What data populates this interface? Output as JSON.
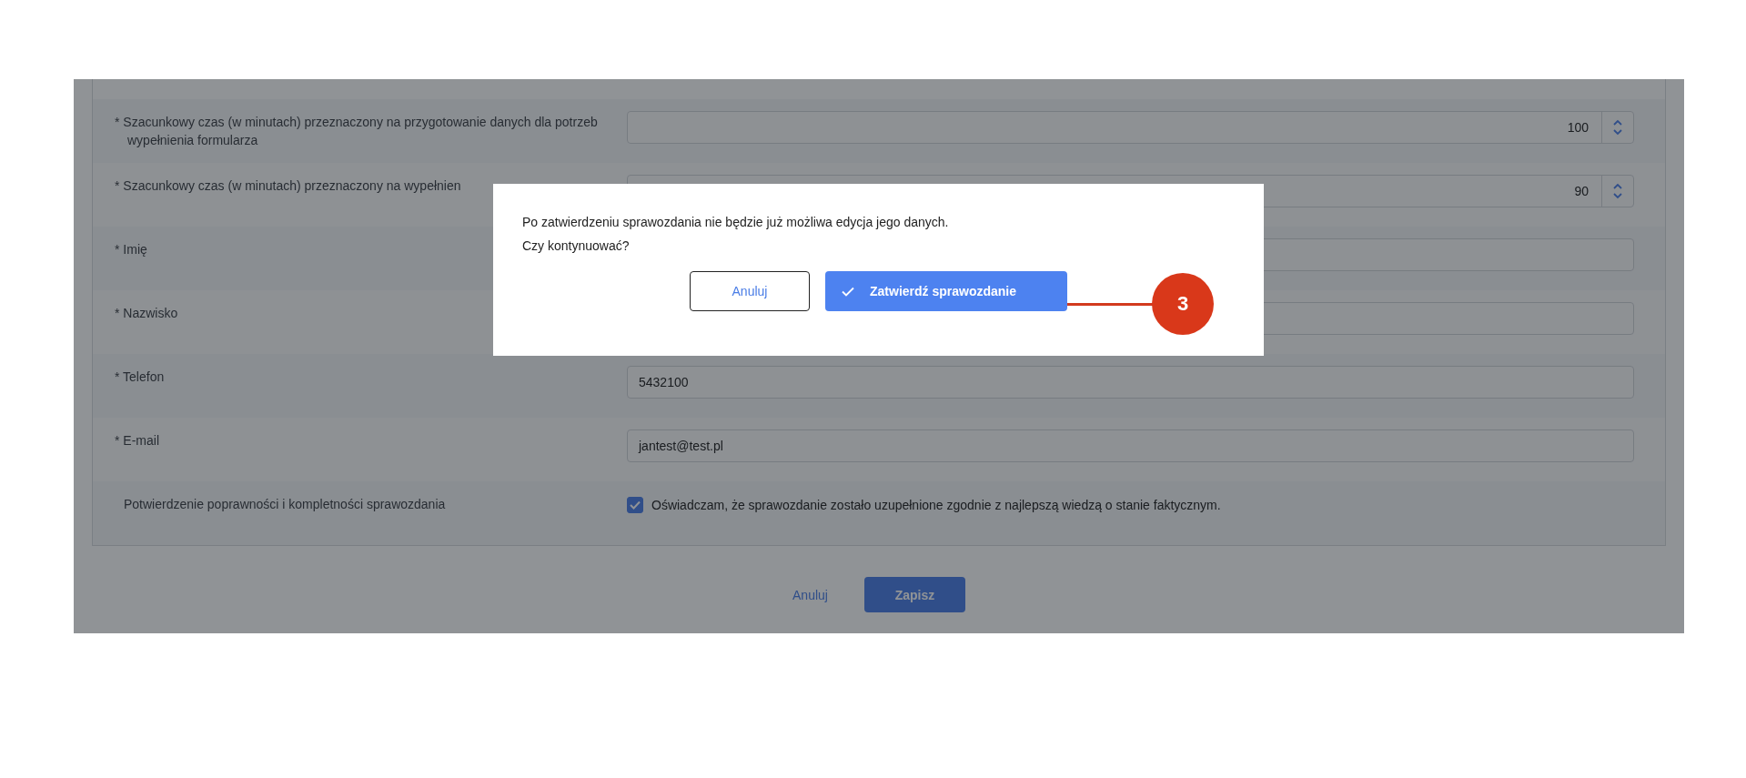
{
  "form": {
    "rows": [
      {
        "kind": "number",
        "label": "* Szacunkowy czas (w minutach) przeznaczony na przygotowanie danych dla potrzeb wypełnienia formularza",
        "value": "100"
      },
      {
        "kind": "number",
        "label": "* Szacunkowy czas (w minutach) przeznaczony na wypełnien",
        "value": "90"
      },
      {
        "kind": "text",
        "label": "* Imię"
      },
      {
        "kind": "text",
        "label": "* Nazwisko"
      },
      {
        "kind": "text",
        "label": "* Telefon",
        "value": "5432100"
      },
      {
        "kind": "text",
        "label": "* E-mail",
        "value": "jantest@test.pl"
      },
      {
        "kind": "checkbox",
        "label": "Potwierdzenie poprawności i kompletności sprawozdania",
        "checked": true,
        "text": "Oświadczam, że sprawozdanie zostało uzupełnione zgodnie z najlepszą wiedzą o stanie faktycznym."
      }
    ]
  },
  "footer": {
    "cancel": "Anuluj",
    "save": "Zapisz"
  },
  "dialog": {
    "message_lines": [
      "Po zatwierdzeniu sprawozdania nie będzie już możliwa edycja jego danych.",
      "Czy kontynuować?"
    ],
    "cancel": "Anuluj",
    "confirm": "Zatwierdź sprawozdanie"
  },
  "callout": {
    "number": "3"
  }
}
